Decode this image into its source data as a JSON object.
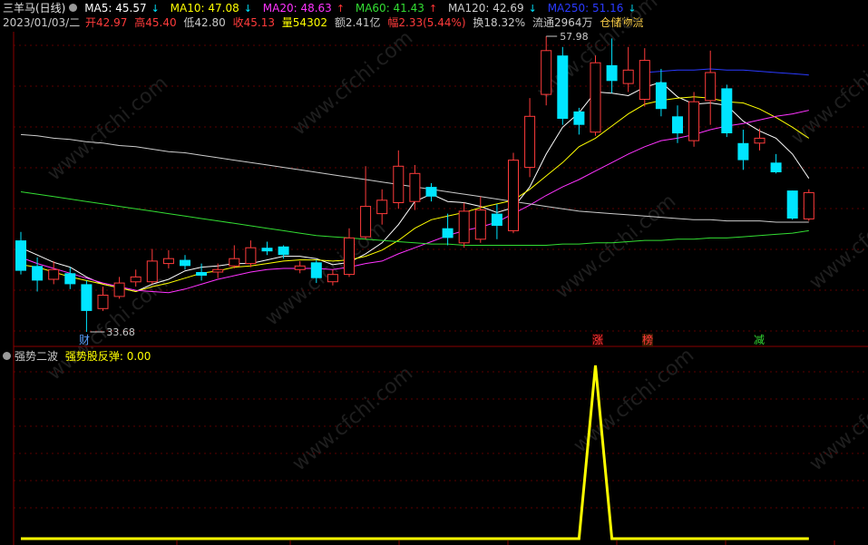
{
  "header": {
    "title": "三羊马(日线)",
    "ma": [
      {
        "label": "MA5: 45.57",
        "color": "#ffffff",
        "arrow": "↓",
        "arrow_color": "#00e5ff"
      },
      {
        "label": "MA10: 47.08",
        "color": "#ffff00",
        "arrow": "↓",
        "arrow_color": "#00e5ff"
      },
      {
        "label": "MA20: 48.63",
        "color": "#ff33ff",
        "arrow": "↑",
        "arrow_color": "#ff3333"
      },
      {
        "label": "MA60: 41.43",
        "color": "#33dd33",
        "arrow": "↑",
        "arrow_color": "#ff3333"
      },
      {
        "label": "MA120: 42.69",
        "color": "#cccccc",
        "arrow": "↓",
        "arrow_color": "#00e5ff"
      },
      {
        "label": "MA250: 51.16",
        "color": "#2a3aff",
        "arrow": "↓",
        "arrow_color": "#00e5ff"
      }
    ],
    "info": {
      "date": "2023/01/03/二",
      "open": "开42.97",
      "high": "高45.40",
      "low": "低42.80",
      "close": "收45.13",
      "volume": "量54302",
      "amount": "额2.41亿",
      "change": "幅2.33(5.44%)",
      "turnover": "换18.32%",
      "float": "流通2964万",
      "sector": "仓储物流"
    }
  },
  "price_labels": {
    "high_marker": "57.98",
    "low_marker": "33.68"
  },
  "event_tags": {
    "cai": "财",
    "zhang": "涨",
    "bang": "榜",
    "jian": "减"
  },
  "indicator": {
    "name": "强势二波",
    "series_label": "强势股反弹: 0.00",
    "value": 0.0
  },
  "watermark": "www.cfchi.com",
  "colors": {
    "up": "#ff3b3b",
    "down": "#00e5ff",
    "ma5": "#ffffff",
    "ma10": "#ffff00",
    "ma20": "#ff33ff",
    "ma60": "#33dd33",
    "ma120": "#cccccc",
    "ma250": "#2a3aff",
    "grid": "#5a0000",
    "indicator": "#ffff00"
  },
  "chart_data": [
    {
      "type": "candlestick",
      "title": "三羊马(日线)",
      "y_marked_high": 57.98,
      "y_marked_low": 33.68,
      "candles": [
        {
          "o": 41.2,
          "c": 38.7,
          "h": 41.9,
          "l": 38.4
        },
        {
          "o": 39.1,
          "c": 37.9,
          "h": 39.8,
          "l": 37.0
        },
        {
          "o": 38.0,
          "c": 38.8,
          "h": 39.5,
          "l": 37.6
        },
        {
          "o": 38.5,
          "c": 37.6,
          "h": 39.0,
          "l": 37.2
        },
        {
          "o": 37.6,
          "c": 35.4,
          "h": 37.9,
          "l": 33.68
        },
        {
          "o": 35.6,
          "c": 36.7,
          "h": 37.4,
          "l": 35.4
        },
        {
          "o": 36.6,
          "c": 37.7,
          "h": 38.2,
          "l": 36.4
        },
        {
          "o": 37.8,
          "c": 38.2,
          "h": 38.8,
          "l": 37.4
        },
        {
          "o": 37.8,
          "c": 39.5,
          "h": 40.5,
          "l": 37.6
        },
        {
          "o": 39.3,
          "c": 39.7,
          "h": 40.4,
          "l": 38.9
        },
        {
          "o": 39.6,
          "c": 39.1,
          "h": 40.0,
          "l": 38.8
        },
        {
          "o": 38.6,
          "c": 38.3,
          "h": 39.3,
          "l": 37.9
        },
        {
          "o": 38.6,
          "c": 38.8,
          "h": 39.3,
          "l": 38.1
        },
        {
          "o": 39.1,
          "c": 39.7,
          "h": 40.8,
          "l": 38.9
        },
        {
          "o": 39.3,
          "c": 40.6,
          "h": 41.2,
          "l": 39.0
        },
        {
          "o": 40.6,
          "c": 40.3,
          "h": 41.1,
          "l": 40.0
        },
        {
          "o": 40.7,
          "c": 40.0,
          "h": 40.8,
          "l": 39.7
        },
        {
          "o": 38.8,
          "c": 39.1,
          "h": 39.5,
          "l": 38.5
        },
        {
          "o": 39.4,
          "c": 38.1,
          "h": 39.6,
          "l": 37.7
        },
        {
          "o": 37.8,
          "c": 38.4,
          "h": 38.8,
          "l": 37.5
        },
        {
          "o": 38.4,
          "c": 41.4,
          "h": 42.2,
          "l": 38.2
        },
        {
          "o": 41.5,
          "c": 44.0,
          "h": 47.3,
          "l": 41.3
        },
        {
          "o": 43.4,
          "c": 44.5,
          "h": 45.4,
          "l": 42.5
        },
        {
          "o": 44.3,
          "c": 47.3,
          "h": 48.6,
          "l": 43.8
        },
        {
          "o": 44.4,
          "c": 46.7,
          "h": 47.4,
          "l": 43.7
        },
        {
          "o": 45.6,
          "c": 44.8,
          "h": 45.9,
          "l": 44.4
        },
        {
          "o": 42.2,
          "c": 41.4,
          "h": 43.4,
          "l": 40.8
        },
        {
          "o": 41.0,
          "c": 43.6,
          "h": 44.3,
          "l": 40.6
        },
        {
          "o": 41.3,
          "c": 43.7,
          "h": 44.8,
          "l": 41.0
        },
        {
          "o": 43.4,
          "c": 42.4,
          "h": 44.2,
          "l": 41.3
        },
        {
          "o": 42.0,
          "c": 47.8,
          "h": 48.4,
          "l": 41.8
        },
        {
          "o": 47.2,
          "c": 51.4,
          "h": 52.9,
          "l": 46.4
        },
        {
          "o": 53.2,
          "c": 56.8,
          "h": 57.98,
          "l": 52.3
        },
        {
          "o": 56.4,
          "c": 51.2,
          "h": 57.1,
          "l": 50.7
        },
        {
          "o": 51.8,
          "c": 50.7,
          "h": 52.1,
          "l": 49.9
        },
        {
          "o": 50.1,
          "c": 55.8,
          "h": 56.4,
          "l": 49.8
        },
        {
          "o": 55.6,
          "c": 54.3,
          "h": 57.8,
          "l": 53.3
        },
        {
          "o": 54.1,
          "c": 55.2,
          "h": 57.1,
          "l": 53.4
        },
        {
          "o": 52.8,
          "c": 56.0,
          "h": 57.0,
          "l": 52.2
        },
        {
          "o": 54.2,
          "c": 52.0,
          "h": 55.3,
          "l": 51.4
        },
        {
          "o": 51.4,
          "c": 50.0,
          "h": 52.3,
          "l": 49.2
        },
        {
          "o": 49.4,
          "c": 52.6,
          "h": 53.4,
          "l": 48.9
        },
        {
          "o": 52.7,
          "c": 55.0,
          "h": 56.8,
          "l": 50.7
        },
        {
          "o": 53.7,
          "c": 50.0,
          "h": 54.0,
          "l": 49.7
        },
        {
          "o": 49.2,
          "c": 47.8,
          "h": 50.3,
          "l": 47.0
        },
        {
          "o": 49.2,
          "c": 49.6,
          "h": 50.4,
          "l": 48.6
        },
        {
          "o": 47.6,
          "c": 46.8,
          "h": 48.3,
          "l": 46.7
        },
        {
          "o": 45.3,
          "c": 43.0,
          "h": 45.3,
          "l": 42.9
        },
        {
          "o": 42.97,
          "c": 45.13,
          "h": 45.4,
          "l": 42.8
        }
      ],
      "ma_lines": {
        "MA5": [
          40.6,
          40.0,
          39.4,
          39.0,
          38.2,
          37.6,
          37.3,
          37.0,
          37.6,
          38.0,
          38.7,
          39.0,
          39.1,
          39.3,
          39.3,
          39.6,
          39.9,
          39.9,
          39.7,
          39.2,
          39.4,
          40.1,
          41.0,
          42.5,
          44.4,
          45.0,
          44.4,
          44.3,
          44.0,
          43.5,
          43.9,
          45.6,
          48.3,
          50.5,
          51.7,
          53.4,
          53.3,
          53.1,
          53.8,
          54.2,
          53.0,
          52.4,
          52.5,
          52.3,
          51.0,
          50.2,
          49.6,
          48.3,
          46.3
        ],
        "MA10": [
          39.2,
          39.0,
          38.6,
          38.2,
          37.9,
          37.6,
          37.3,
          37.0,
          37.4,
          37.7,
          38.1,
          38.5,
          38.7,
          39.0,
          39.1,
          39.3,
          39.5,
          39.6,
          39.6,
          39.5,
          39.6,
          39.9,
          40.4,
          41.2,
          42.2,
          42.9,
          43.2,
          43.5,
          43.9,
          44.2,
          44.5,
          45.4,
          46.5,
          47.6,
          48.9,
          49.6,
          50.6,
          51.6,
          52.4,
          52.7,
          52.9,
          53.0,
          52.9,
          52.6,
          52.5,
          52.0,
          51.3,
          50.5,
          49.6
        ],
        "MA20": [
          39.8,
          39.3,
          38.9,
          38.5,
          38.1,
          37.7,
          37.4,
          37.1,
          37.0,
          36.9,
          37.2,
          37.6,
          38.0,
          38.3,
          38.6,
          38.8,
          38.9,
          38.9,
          38.9,
          38.8,
          39.0,
          39.3,
          39.5,
          40.1,
          40.6,
          41.1,
          41.6,
          42.0,
          42.3,
          42.7,
          43.4,
          44.1,
          44.9,
          45.6,
          46.2,
          46.9,
          47.6,
          48.3,
          48.9,
          49.4,
          49.6,
          49.9,
          50.3,
          50.6,
          50.8,
          51.1,
          51.4,
          51.6,
          51.9
        ],
        "MA60": [
          45.2,
          45.0,
          44.8,
          44.6,
          44.4,
          44.2,
          44.0,
          43.8,
          43.6,
          43.4,
          43.2,
          43.0,
          42.8,
          42.6,
          42.4,
          42.2,
          42.0,
          41.8,
          41.6,
          41.5,
          41.4,
          41.3,
          41.2,
          41.1,
          41.0,
          40.9,
          40.9,
          40.8,
          40.8,
          40.8,
          40.8,
          40.8,
          40.8,
          40.9,
          40.9,
          41.0,
          41.0,
          41.1,
          41.2,
          41.2,
          41.3,
          41.3,
          41.4,
          41.4,
          41.5,
          41.6,
          41.7,
          41.8,
          42.0
        ],
        "MA120": [
          49.9,
          49.8,
          49.6,
          49.5,
          49.3,
          49.2,
          49.0,
          48.9,
          48.7,
          48.5,
          48.4,
          48.2,
          48.0,
          47.8,
          47.6,
          47.4,
          47.2,
          47.0,
          46.8,
          46.6,
          46.4,
          46.2,
          46.0,
          45.8,
          45.6,
          45.4,
          45.2,
          45.0,
          44.8,
          44.6,
          44.4,
          44.2,
          44.0,
          43.8,
          43.6,
          43.5,
          43.4,
          43.3,
          43.2,
          43.1,
          43.0,
          42.9,
          42.9,
          42.8,
          42.8,
          42.8,
          42.7,
          42.7,
          42.7
        ],
        "MA250": [
          null,
          null,
          null,
          null,
          null,
          null,
          null,
          null,
          null,
          null,
          null,
          null,
          null,
          null,
          null,
          null,
          null,
          null,
          null,
          null,
          null,
          null,
          null,
          null,
          null,
          null,
          null,
          null,
          null,
          null,
          null,
          null,
          null,
          null,
          null,
          null,
          null,
          null,
          55.0,
          55.1,
          55.2,
          55.2,
          55.3,
          55.2,
          55.2,
          55.1,
          55.0,
          54.9,
          54.8
        ]
      }
    },
    {
      "type": "line",
      "title": "强势二波",
      "series": [
        {
          "name": "强势股反弹",
          "values": [
            0,
            0,
            0,
            0,
            0,
            0,
            0,
            0,
            0,
            0,
            0,
            0,
            0,
            0,
            0,
            0,
            0,
            0,
            0,
            0,
            0,
            0,
            0,
            0,
            0,
            0,
            0,
            0,
            0,
            0,
            0,
            0,
            0,
            0,
            0,
            1,
            0,
            0,
            0,
            0,
            0,
            0,
            0,
            0,
            0,
            0,
            0,
            0,
            0
          ]
        }
      ]
    }
  ]
}
